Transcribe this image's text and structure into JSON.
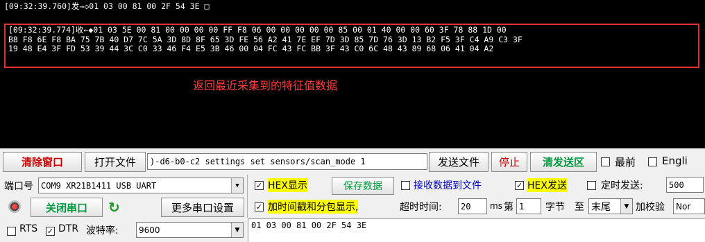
{
  "terminal": {
    "tx_line": "[09:32:39.760]发→◇01 03 00 81 00 2F 54 3E □",
    "rx_header": "[09:32:39.774]收←◆01 03 5E 00 81 00 00 00 00 FF F8 06 00 00 00 00 00 85 00 01 40 00 00 60 3F 78 88 1D 00",
    "rx_line2": "B8 F8 6E F8 BA 75 7B 40 D7 7C 5A 3D 8D 8F 65 3D FE 56 A2 41 7E EF 7D 3D 85 7D 76 3D 13 B2 F5 3F C4 A9 C3 3F",
    "rx_line3": "19 48 E4 3F FD 53 39 44 3C C0 33 46 F4 E5 3B 46 00 04 FC 43 FC BB 3F 43 C0 6C 48 43 89 68 06 41 04 A2",
    "annotation": "返回最近采集到的特征值数据",
    "annotation_color": "#ff3b3b",
    "box_color": "#e03131"
  },
  "toolbar": {
    "clear_window": "清除窗口",
    "open_file": "打开文件",
    "command_input": ")-d6-b0-c2 settings set sensors/scan_mode 1",
    "send_file": "发送文件",
    "stop": "停止",
    "clear_send": "清发送区",
    "topmost_label": "最前",
    "english_label": "Engli"
  },
  "port": {
    "port_label": "端口号",
    "port_value": "COM9 XR21B1411 USB UART",
    "close_port": "关闭串口",
    "more_settings": "更多串口设置",
    "rts_label": "RTS",
    "dtr_label": "DTR",
    "baud_label": "波特率:",
    "baud_value": "9600"
  },
  "options": {
    "hex_display": "HEX显示",
    "save_data": "保存数据",
    "receive_to_file": "接收数据到文件",
    "hex_send": "HEX发送",
    "timed_send": "定时发送:",
    "timed_value": "500",
    "add_timestamp": "加时间戳和分包显示,",
    "timeout_label": "超时时间:",
    "timeout_value": "20",
    "ms_label": "ms",
    "nth_label": "第",
    "nth_value": "1",
    "byte_label": "字节",
    "to_label": "至",
    "end_value": "末尾",
    "checksum_label": "加校验",
    "checksum_value": "Nor"
  },
  "send": {
    "text": "01 03 00 81 00 2F 54 3E"
  }
}
